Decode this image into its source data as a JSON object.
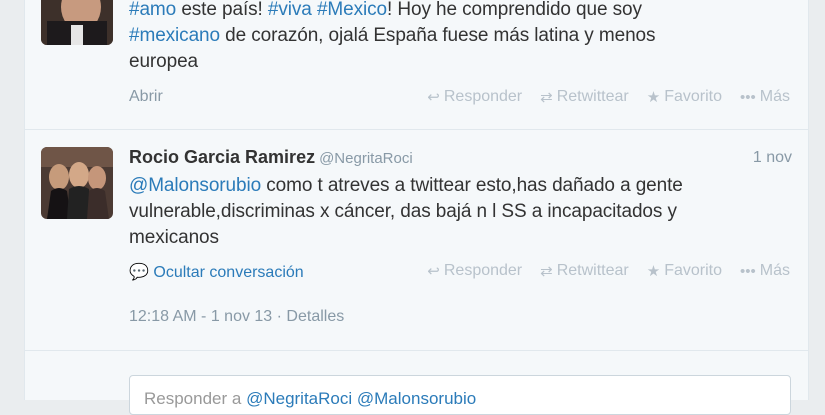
{
  "previous_tweet": {
    "text_parts": {
      "h1": "#amo",
      "t1": " este país! ",
      "h2": "#viva",
      "t2": " ",
      "h3": "#Mexico",
      "t3": "! Hoy he comprendido que soy",
      "h4": "#mexicano",
      "t4": " de corazón, ojalá España fuese más latina y menos",
      "t5": "europea"
    },
    "expand_label": "Abrir",
    "actions": {
      "reply": "Responder",
      "retweet": "Retwittear",
      "favorite": "Favorito",
      "more": "Más"
    }
  },
  "main_tweet": {
    "name": "Rocio Garcia Ramirez",
    "handle": "@NegritaRoci",
    "date": "1 nov",
    "text_parts": {
      "mention": "@Malonsorubio",
      "t1": " como t atreves a twittear esto,has dañado a gente",
      "t2": "vulnerable,discriminas x cáncer, das bajá n l SS a incapacitados y",
      "t3": "mexicanos"
    },
    "hide_conversation": "Ocultar conversación",
    "actions": {
      "reply": "Responder",
      "retweet": "Retwittear",
      "favorite": "Favorito",
      "more": "Más"
    },
    "timestamp": "12:18 AM - 1 nov 13",
    "separator": " · ",
    "details": "Detalles"
  },
  "reply": {
    "prefix": "Responder a ",
    "mention1": "@NegritaRoci",
    "mention2": "@Malonsorubio"
  },
  "colors": {
    "link": "#2b7bb9",
    "muted": "#8899a6",
    "background": "#f5f8fa"
  },
  "icons": [
    "reply-icon",
    "retweet-icon",
    "star-icon",
    "more-icon",
    "speech-bubble-icon"
  ]
}
